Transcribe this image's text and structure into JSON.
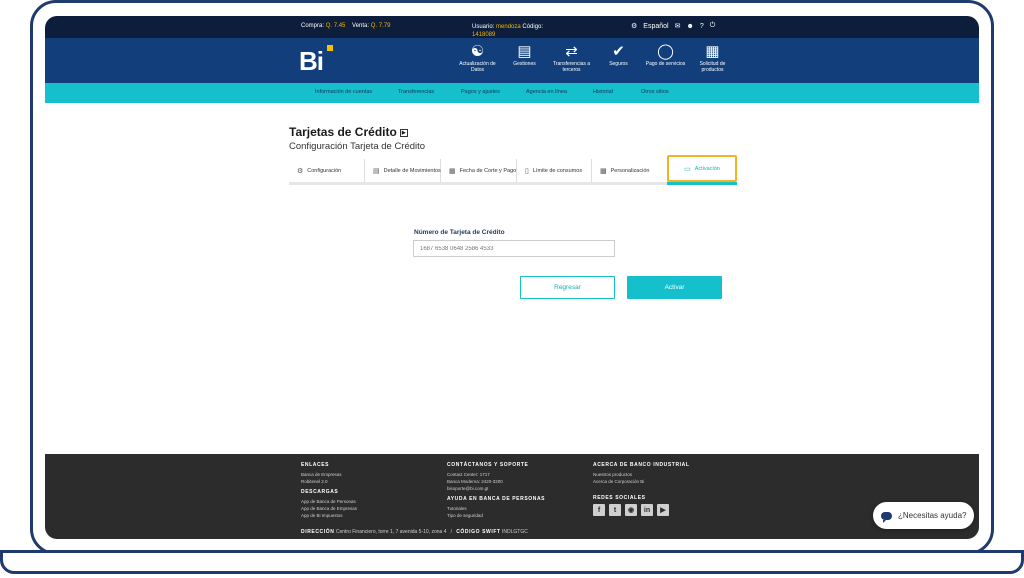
{
  "topbar": {
    "compra_label": "Compra:",
    "compra_value": "Q. 7.45",
    "venta_label": "Venta:",
    "venta_value": "Q. 7.79",
    "usuario_label": "Usuario:",
    "usuario_value": "mendoza",
    "codigo_label": "Código:",
    "codigo_value": "1418089",
    "language": "Español",
    "help_symbol": "?"
  },
  "brand": {
    "logo_text": "Bi",
    "accent_color": "#f7c300"
  },
  "nav": {
    "items": [
      {
        "label": "Actualización de Datos",
        "icon": "user-icon"
      },
      {
        "label": "Gestiones",
        "icon": "document-icon"
      },
      {
        "label": "Transferencias a terceros",
        "icon": "transfer-icon"
      },
      {
        "label": "Seguros",
        "icon": "shield-icon"
      },
      {
        "label": "Pago de servicios",
        "icon": "lightbulb-icon"
      },
      {
        "label": "Solicitud de productos",
        "icon": "request-icon"
      }
    ]
  },
  "subnav": {
    "items": [
      "Información de cuentas",
      "Transferencias",
      "Pagos y ajustes",
      "Agencia en línea",
      "Historial",
      "Otros sitios"
    ]
  },
  "page": {
    "title": "Tarjetas de Crédito",
    "subtitle": "Configuración Tarjeta de Crédito"
  },
  "tabs": [
    {
      "label": "Configuración",
      "icon": "gear-icon"
    },
    {
      "label": "Detalle de Movimientos",
      "icon": "list-icon"
    },
    {
      "label": "Fecha de Corte y Pago",
      "icon": "calendar-icon"
    },
    {
      "label": "Límite de consumos",
      "icon": "limit-icon"
    },
    {
      "label": "Personalización",
      "icon": "card-design-icon"
    },
    {
      "label": "Activación",
      "icon": "credit-card-icon"
    }
  ],
  "form": {
    "card_label": "Número de Tarjeta de Crédito",
    "card_value": "1687 6538 0648 2586 4533",
    "back_button": "Regresar",
    "activate_button": "Activar"
  },
  "footer": {
    "enlaces_title": "ENLACES",
    "enlaces": [
      "Banca de Empresas",
      "Robitenel 2.0"
    ],
    "descargas_title": "DESCARGAS",
    "descargas": [
      "App de Banca de Personas",
      "App de Banca de Empresas",
      "App de Bi Impuestos"
    ],
    "contacto_title": "CONTÁCTANOS Y SOPORTE",
    "contacto": [
      "Contact Center: 1717",
      "Banca Moderna: 2420-3200",
      "bisoporte@bi.com.gt"
    ],
    "ayuda_title": "AYUDA EN BANCA DE PERSONAS",
    "ayuda": [
      "Tutoriales",
      "Tipo de seguridad"
    ],
    "acerca_title": "ACERCA DE BANCO INDUSTRIAL",
    "acerca": [
      "Nuestros productos",
      "Acerca de Corporación Bi"
    ],
    "redes_title": "REDES SOCIALES",
    "direccion_label": "DIRECCIÓN",
    "direccion_value": "Centro Financiero, torre 1, 7 avenida 5-10, zona 4",
    "swift_label": "CÓDIGO SWIFT",
    "swift_value": "INDLGTGC"
  },
  "help_widget": {
    "label": "¿Necesitas ayuda?"
  },
  "colors": {
    "navy": "#123f7c",
    "teal": "#15bfcb",
    "highlight": "#f5b321"
  }
}
